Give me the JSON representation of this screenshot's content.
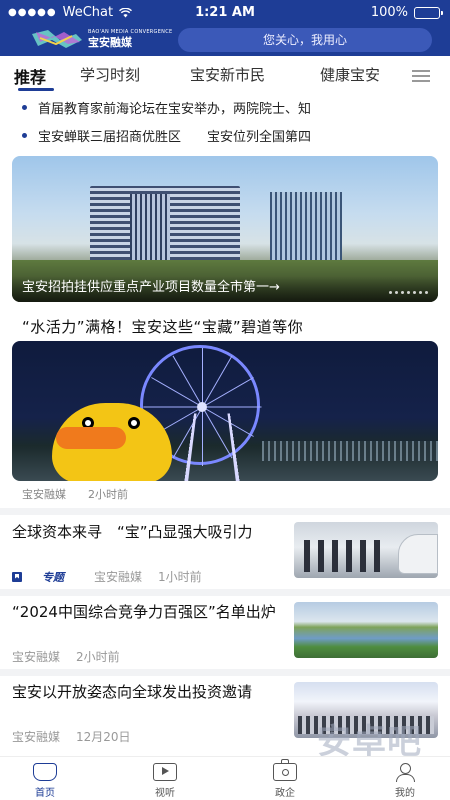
{
  "status_bar": {
    "carrier": "WeChat",
    "time": "1:21 AM",
    "battery": "100%"
  },
  "header": {
    "logo_en": "BAO'AN MEDIA CONVERGENCE",
    "logo_cn": "宝安融媒",
    "search_placeholder": "您关心，我用心"
  },
  "tabs": [
    {
      "label": "推荐",
      "active": true
    },
    {
      "label": "学习时刻",
      "active": false
    },
    {
      "label": "宝安新市民",
      "active": false
    },
    {
      "label": "健康宝安",
      "active": false
    }
  ],
  "ticker": [
    "首届教育家前海论坛在宝安举办，两院院士、知",
    "宝安蝉联三届招商优胜区　　宝安位列全国第四"
  ],
  "banner": {
    "caption": "宝安招拍挂供应重点产业项目数量全市第一→"
  },
  "feature": {
    "title": "“水活力”满格！宝安这些“宝藏”碧道等你",
    "source": "宝安融媒",
    "time": "2小时前"
  },
  "articles": [
    {
      "title": "全球资本来寻　“宝”凸显强大吸引力",
      "tag": "专题",
      "source": "宝安融媒",
      "time": "1小时前"
    },
    {
      "title": "“2024中国综合竞争力百强区”名单出炉",
      "tag": "",
      "source": "宝安融媒",
      "time": "2小时前"
    },
    {
      "title": "宝安以开放姿态向全球发出投资邀请",
      "tag": "",
      "source": "宝安融媒",
      "time": "12月20日"
    }
  ],
  "bottom_nav": [
    {
      "label": "首页",
      "icon": "home-icon",
      "active": true
    },
    {
      "label": "视听",
      "icon": "video-icon",
      "active": false
    },
    {
      "label": "政企",
      "icon": "briefcase-icon",
      "active": false
    },
    {
      "label": "我的",
      "icon": "user-icon",
      "active": false
    }
  ],
  "watermark": "安卓吧",
  "colors": {
    "brand": "#1e3d96",
    "search_bg": "#3b59b8"
  }
}
